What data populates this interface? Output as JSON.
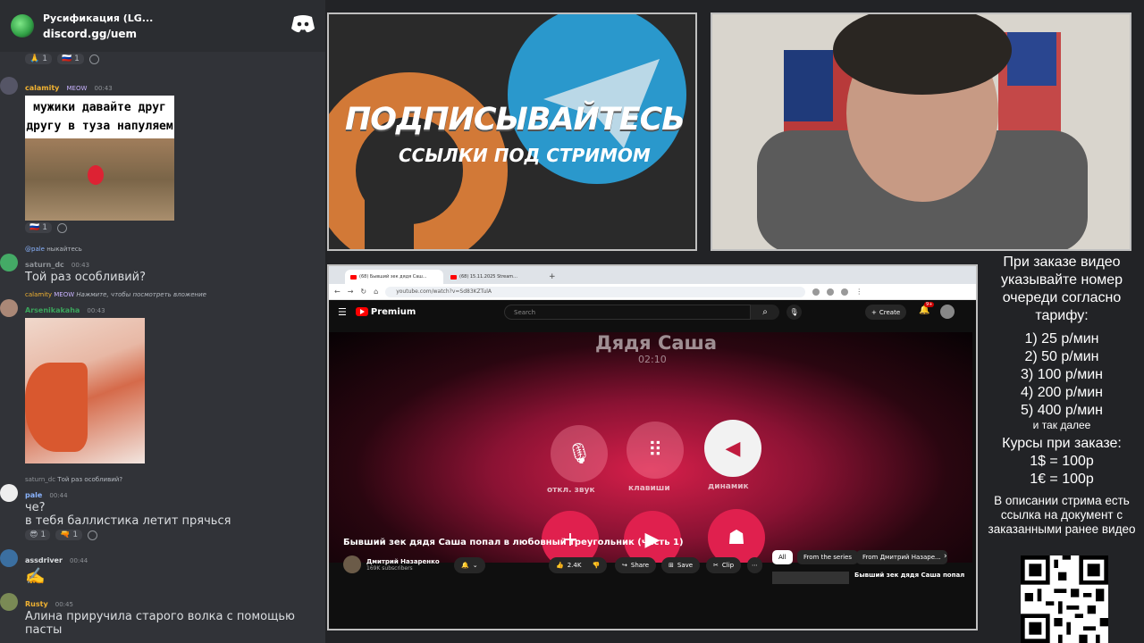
{
  "chat": {
    "server_title": "Русификация (LG...",
    "server_link": "discord.gg/uem",
    "top_reactions": [
      "1",
      "1"
    ],
    "messages": [
      {
        "user": "calamity",
        "tag": "MEOW",
        "time": "00:43",
        "meme_text": "мужики давайте друг другу в туза напуляем",
        "reactions": [
          "1"
        ]
      },
      {
        "reply_user": "@pale",
        "reply_text": "ныкайтесь",
        "user": "saturn_dc",
        "time": "00:43",
        "text": "Той раз особливий?"
      },
      {
        "reply_user": "calamity",
        "reply_tag": "MEOW",
        "reply_text": "Нажмите, чтобы посмотреть вложение",
        "user": "Arsenikakaha",
        "time": "00:43"
      },
      {
        "reply_user": "saturn_dc",
        "reply_text": "Той раз особливий?",
        "user": "pale",
        "time": "00:44",
        "lines": [
          "че?",
          "в тебя баллистика летит прячься"
        ],
        "reactions": [
          "1",
          "1"
        ]
      },
      {
        "user": "assdriver",
        "time": "00:44",
        "text": ""
      },
      {
        "user": "Rusty",
        "time": "00:45",
        "text": "Алина приручила старого волка с помощью пасты"
      }
    ]
  },
  "promo": {
    "title": "ПОДПИСЫВАЙТЕСЬ",
    "subtitle": "ССЫЛКИ ПОД СТРИМОМ"
  },
  "browser": {
    "tabs": [
      "(68) Бывший зек дядя Саш...",
      "(68) 15.11.2025 Stream...",
      "+"
    ],
    "url": "youtube.com/watch?v=Sd83KZTulA",
    "yt_brand": "Premium",
    "search_placeholder": "Search",
    "create_label": "Create",
    "notif_count": "9+",
    "video": {
      "caller_name": "Дядя Саша",
      "call_time": "02:10",
      "buttons": [
        "откл. звук",
        "клавиши",
        "динамик"
      ]
    },
    "video_title": "Бывший зек дядя Саша попал в любовный треугольник (часть 1)",
    "channel_name": "Дмитрий Назаренко",
    "channel_subs": "169K subscribers",
    "likes": "2.4K",
    "share": "Share",
    "save": "Save",
    "clip": "Clip",
    "chips": [
      "All",
      "From the series",
      "From Дмитрий Назаре..."
    ],
    "rec_title": "Бывший зек дядя Саша попал"
  },
  "info": {
    "heading": "При заказе видео указывайте номер очереди согласно тарифу:",
    "tariffs": [
      "1) 25 р/мин",
      "2) 50 р/мин",
      "3) 100 р/мин",
      "4) 200 р/мин",
      "5) 400 р/мин"
    ],
    "etc": "и так далее",
    "rates_title": "Курсы при заказе:",
    "rates": [
      "1$ = 100р",
      "1€ = 100р"
    ],
    "note": "В описании стрима есть ссылка на документ с заказанными ранее видео"
  },
  "colors": {
    "discord_bg": "#313338",
    "yt_red": "#ff0000",
    "accent_orange": "#f0873a",
    "telegram_blue": "#2aa4de"
  }
}
